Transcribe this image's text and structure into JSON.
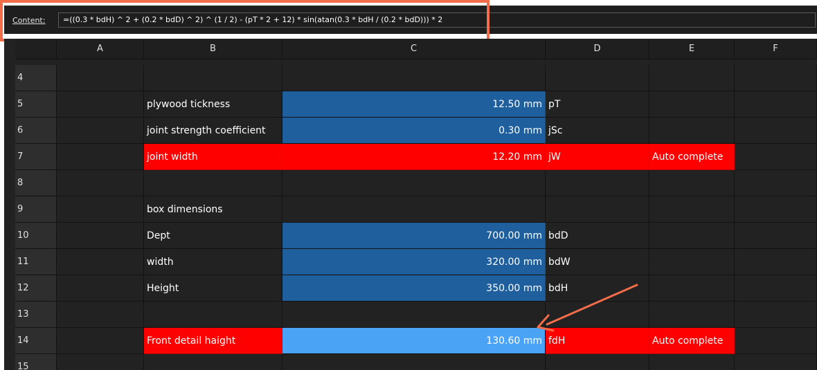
{
  "toolbar": {
    "content_label": "Content:",
    "formula": "=((0.3 * bdH) ^ 2 + (0.2 * bdD) ^ 2) ^ (1 / 2) - (pT * 2 + 12) * sin(atan(0.3 * bdH / (0.2 * bdD))) * 2"
  },
  "columns": [
    "A",
    "B",
    "C",
    "D",
    "E",
    "F"
  ],
  "rows": [
    {
      "num": "4",
      "b": "",
      "c": "",
      "d": "",
      "e": ""
    },
    {
      "num": "5",
      "b": "plywood tickness",
      "c": "12.50 mm",
      "d": "pT",
      "e": ""
    },
    {
      "num": "6",
      "b": "joint strength coefficient",
      "c": "0.30 mm",
      "d": "jSc",
      "e": ""
    },
    {
      "num": "7",
      "b": "joint width",
      "c": "12.20 mm",
      "d": "jW",
      "e": "Auto complete"
    },
    {
      "num": "8",
      "b": "",
      "c": "",
      "d": "",
      "e": ""
    },
    {
      "num": "9",
      "b": "box dimensions",
      "c": "",
      "d": "",
      "e": ""
    },
    {
      "num": "10",
      "b": "Dept",
      "c": "700.00 mm",
      "d": "bdD",
      "e": ""
    },
    {
      "num": "11",
      "b": "width",
      "c": "320.00 mm",
      "d": "bdW",
      "e": ""
    },
    {
      "num": "12",
      "b": "Height",
      "c": "350.00 mm",
      "d": "bdH",
      "e": ""
    },
    {
      "num": "13",
      "b": "",
      "c": "",
      "d": "",
      "e": ""
    },
    {
      "num": "14",
      "b": "Front detail haight",
      "c": "130.60 mm",
      "d": "fdH",
      "e": "Auto complete"
    },
    {
      "num": "15",
      "b": "",
      "c": "",
      "d": "",
      "e": ""
    }
  ],
  "colors": {
    "annotation": "#f26d4a",
    "input_cell": "#1f5f9e",
    "selected_cell": "#4aa3f5",
    "auto_complete": "#ff0000"
  }
}
